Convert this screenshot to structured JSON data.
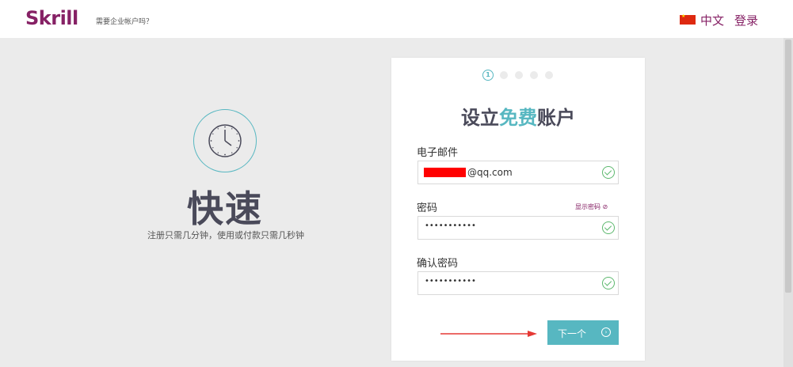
{
  "header": {
    "logo": "Skrill",
    "business_link": "需要企业帐户吗？",
    "language": "中文",
    "login": "登录"
  },
  "promo": {
    "icon": "clock-icon",
    "headline": "快速",
    "subtext": "注册只需几分钟，使用或付款只需几秒钟"
  },
  "form": {
    "step_current": "1",
    "step_total": 5,
    "title_part1": "设立",
    "title_highlight": "免费",
    "title_part2": "账户",
    "email_label": "电子邮件",
    "email_value": "@qq.com",
    "password_label": "密码",
    "show_password": "显示密码",
    "password_value": "•••••••••••",
    "confirm_label": "确认密码",
    "confirm_value": "•••••••••••",
    "next_button": "下一个"
  },
  "colors": {
    "brand": "#862165",
    "accent": "#57b7c1",
    "valid": "#5db86e",
    "arrow": "#e53935"
  }
}
